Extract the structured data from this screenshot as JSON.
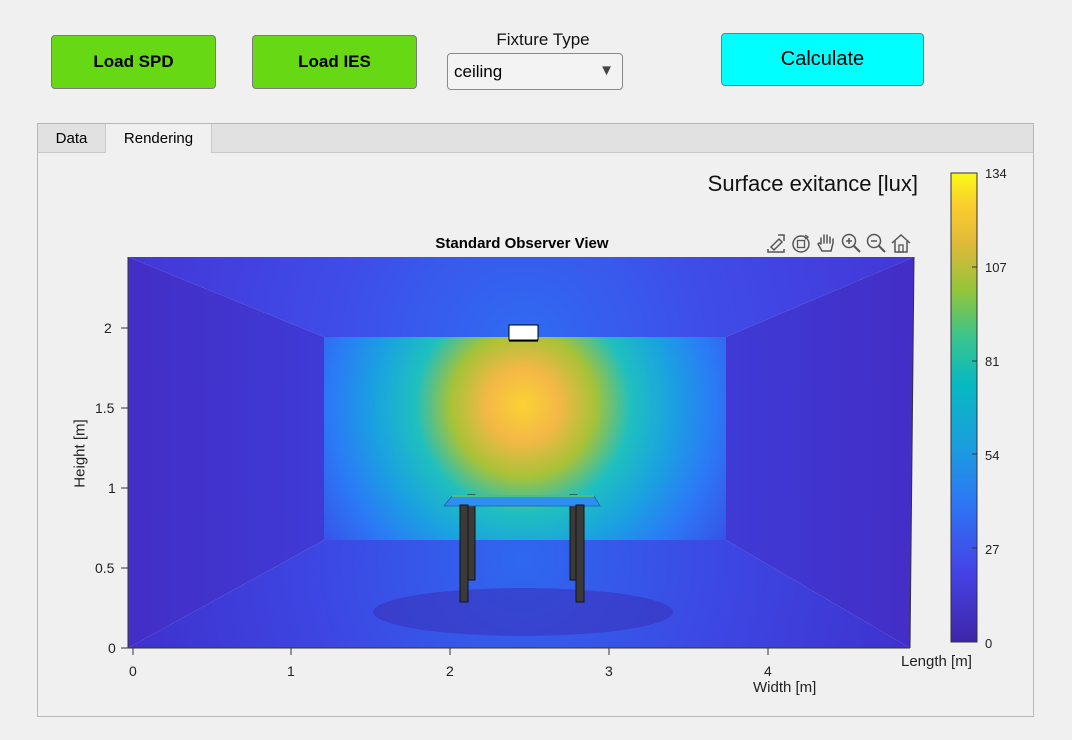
{
  "toolbar": {
    "load_spd": "Load SPD",
    "load_ies": "Load IES",
    "fixture_label": "Fixture Type",
    "fixture_value": "ceiling",
    "calculate": "Calculate"
  },
  "tabs": [
    {
      "label": "Data",
      "active": false
    },
    {
      "label": "Rendering",
      "active": true
    }
  ],
  "colorbar": {
    "title": "Surface exitance [lux]",
    "ticks": [
      "134",
      "107",
      "81",
      "54",
      "27",
      "0"
    ],
    "min": 0,
    "max": 134
  },
  "plot": {
    "title": "Standard Observer View",
    "ylabel": "Height [m]",
    "xlabel": "Width [m]",
    "zlabel": "Length [m]",
    "yticks": [
      "2",
      "1.5",
      "1",
      "0.5",
      "0"
    ],
    "xticks": [
      "0",
      "1",
      "2",
      "3",
      "4"
    ]
  },
  "icons": [
    "export-icon",
    "rotate-3d-icon",
    "pan-icon",
    "zoom-in-icon",
    "zoom-out-icon",
    "home-icon"
  ],
  "colors": {
    "green_button": "#66d914",
    "cyan_button": "#00ffff",
    "room_dark": "#3d2ec0",
    "room_mid": "#2c6cf0",
    "hotspot": "#f7d23a"
  }
}
